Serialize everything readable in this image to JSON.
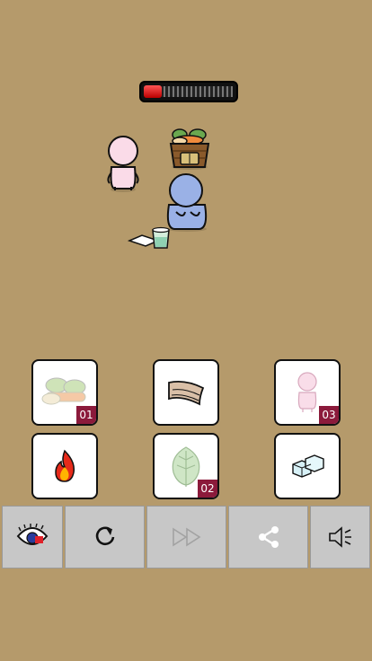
{
  "progress": {
    "level": 0.1,
    "fill_color": "#e11"
  },
  "scene": {
    "characters": [
      "pink-person",
      "blue-person-crying"
    ],
    "objects": [
      "vegetable-basket",
      "glass-of-water",
      "white-paper"
    ]
  },
  "items": [
    {
      "name": "vegetables",
      "icon": "vegetables-icon",
      "count": "01"
    },
    {
      "name": "cloth",
      "icon": "cloth-icon",
      "count": ""
    },
    {
      "name": "pink-person",
      "icon": "pink-person-icon",
      "count": "03"
    },
    {
      "name": "fire",
      "icon": "fire-icon",
      "count": ""
    },
    {
      "name": "leaf",
      "icon": "leaf-icon",
      "count": "02"
    },
    {
      "name": "ice",
      "icon": "ice-icon",
      "count": ""
    }
  ],
  "toolbar": {
    "buttons": [
      {
        "name": "hint",
        "icon": "hint-eye-icon",
        "enabled": true
      },
      {
        "name": "restart",
        "icon": "restart-icon",
        "enabled": true
      },
      {
        "name": "skip",
        "icon": "fast-forward-icon",
        "enabled": false
      },
      {
        "name": "share",
        "icon": "share-icon",
        "enabled": true
      },
      {
        "name": "sound",
        "icon": "speaker-icon",
        "enabled": true
      }
    ]
  },
  "colors": {
    "background": "#b59a6b",
    "badge": "#8b1a3b",
    "toolbar": "#c7c7c7"
  }
}
